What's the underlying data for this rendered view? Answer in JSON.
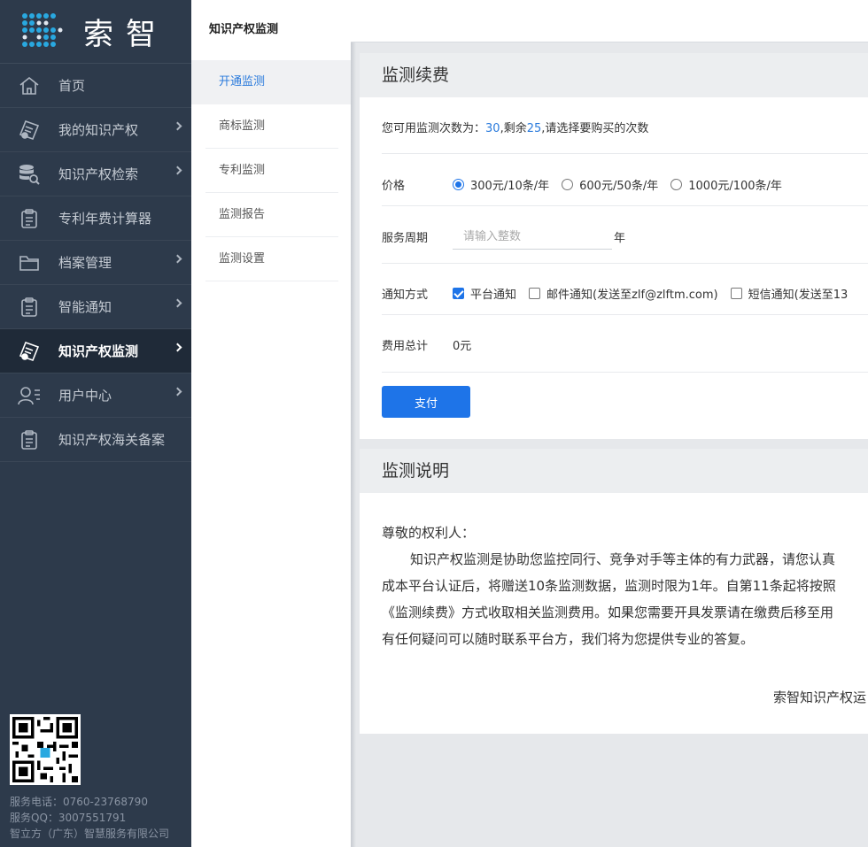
{
  "brand": {
    "logo_text": "索智"
  },
  "sidebar": {
    "items": [
      {
        "label": "首页",
        "icon": "home-icon",
        "arrow": false,
        "active": false
      },
      {
        "label": "我的知识产权",
        "icon": "certificate-icon",
        "arrow": true,
        "active": false
      },
      {
        "label": "知识产权检索",
        "icon": "database-search-icon",
        "arrow": true,
        "active": false
      },
      {
        "label": "专利年费计算器",
        "icon": "clipboard-icon",
        "arrow": false,
        "active": false
      },
      {
        "label": "档案管理",
        "icon": "folder-icon",
        "arrow": true,
        "active": false
      },
      {
        "label": "智能通知",
        "icon": "clipboard-icon",
        "arrow": true,
        "active": false
      },
      {
        "label": "知识产权监测",
        "icon": "certificate-icon",
        "arrow": true,
        "active": true
      },
      {
        "label": "用户中心",
        "icon": "user-icon",
        "arrow": true,
        "active": false
      },
      {
        "label": "知识产权海关备案",
        "icon": "clipboard-icon",
        "arrow": false,
        "active": false
      }
    ],
    "footer": {
      "phone": "服务电话：0760-23768790",
      "qq": "服务QQ：3007551791",
      "company": "智立方（广东）智慧服务有限公司"
    }
  },
  "submenu": {
    "title": "知识产权监测",
    "items": [
      {
        "label": "开通监测",
        "active": true
      },
      {
        "label": "商标监测",
        "active": false
      },
      {
        "label": "专利监测",
        "active": false
      },
      {
        "label": "监测报告",
        "active": false
      },
      {
        "label": "监测设置",
        "active": false
      }
    ]
  },
  "renew": {
    "title": "监测续费",
    "hint_prefix": "您可用监测次数为：",
    "available": "30",
    "hint_mid": ",剩余",
    "remaining": "25",
    "hint_suffix": ",请选择要购买的次数",
    "price_label": "价格",
    "price_options": [
      "300元/10条/年",
      "600元/50条/年",
      "1000元/100条/年"
    ],
    "price_selected": 0,
    "period_label": "服务周期",
    "period_placeholder": "请输入整数",
    "period_unit": "年",
    "notify_label": "通知方式",
    "notify_options": [
      {
        "label": "平台通知",
        "checked": true
      },
      {
        "label": "邮件通知(发送至zlf@zlftm.com)",
        "checked": false
      },
      {
        "label": "短信通知(发送至13",
        "checked": false
      }
    ],
    "total_label": "费用总计",
    "total_value": "0元",
    "pay_button": "支付"
  },
  "description": {
    "title": "监测说明",
    "greeting": "尊敬的权利人：",
    "lines": [
      "知识产权监测是协助您监控同行、竞争对手等主体的有力武器，请您认真",
      "成本平台认证后，将赠送10条监测数据，监测时限为1年。自第11条起将按照",
      "《监测续费》方式收取相关监测费用。如果您需要开具发票请在缴费后移至用",
      "有任何疑问可以随时联系平台方，我们将为您提供专业的答复。"
    ],
    "signature": "索智知识产权运"
  },
  "colors": {
    "accent": "#1e74e8",
    "sidebar_bg": "#2d3a4b",
    "sidebar_active": "#1f2a38"
  }
}
